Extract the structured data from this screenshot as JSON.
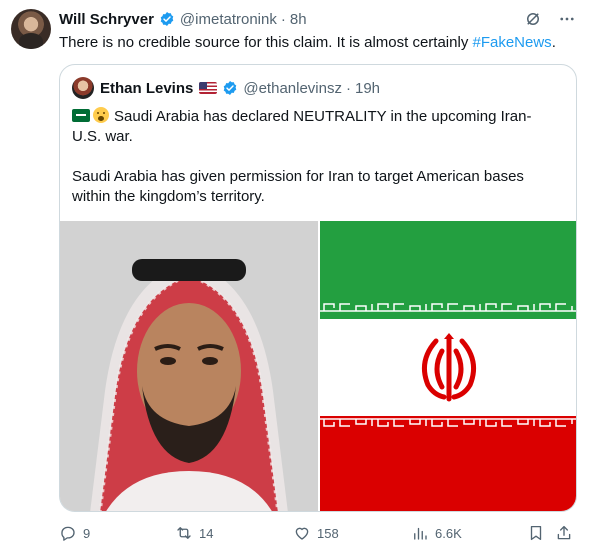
{
  "tweet": {
    "author_name": "Will Schryver",
    "handle": "@imetatronink",
    "separator": "·",
    "time": "8h",
    "text_before": "There is no credible source for this claim. It is almost certainly ",
    "hashtag": "#FakeNews",
    "text_after": "."
  },
  "quote": {
    "author_name": "Ethan Levins",
    "handle": "@ethanlevinsz",
    "separator": "·",
    "time": "19h",
    "line1": "Saudi Arabia has declared NEUTRALITY in the upcoming Iran-",
    "line2": "U.S. war.",
    "line3": "Saudi Arabia has given permission for Iran to target American bases",
    "line4": "within the kingdom’s territory."
  },
  "actions": {
    "replies": "9",
    "reposts": "14",
    "likes": "158",
    "views": "6.6K"
  },
  "colors": {
    "link": "#1d9bf0",
    "muted": "#536471",
    "iran_green": "#239f40",
    "iran_red": "#da0000"
  },
  "icons": [
    "verified-badge-icon",
    "grok-icon",
    "more-icon",
    "us-flag-icon",
    "saudi-flag-icon",
    "astonished-emoji-icon",
    "reply-icon",
    "repost-icon",
    "like-icon",
    "views-icon",
    "bookmark-icon",
    "share-icon"
  ]
}
